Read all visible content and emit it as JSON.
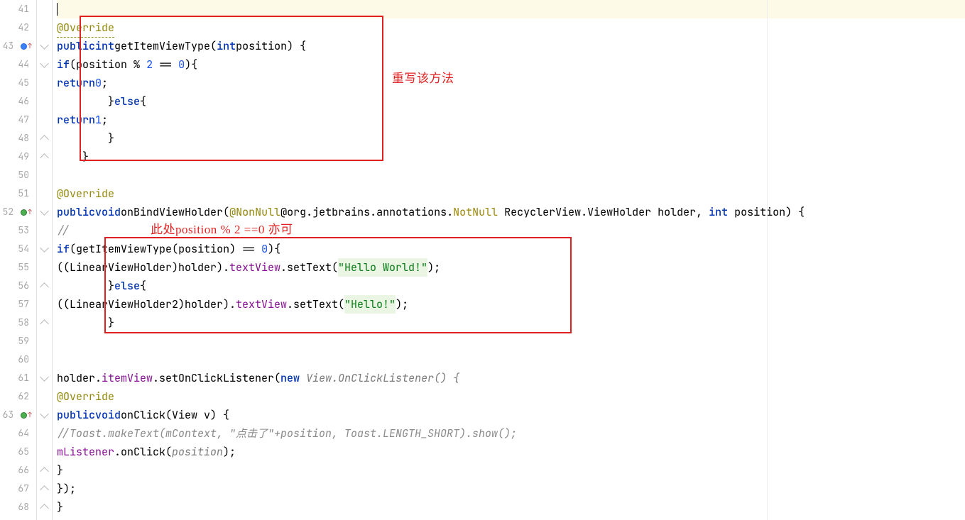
{
  "lines": {
    "start": 41,
    "end": 68
  },
  "annotations": {
    "box1_label": "重写该方法",
    "box2_label": "此处position % 2 ==0 亦可"
  },
  "code": {
    "override1": "@Override",
    "getItemViewType": {
      "sig_public": "public",
      "sig_int1": "int",
      "sig_method": "getItemViewType",
      "sig_int2": "int",
      "sig_param": "position"
    },
    "if1_pre": "if",
    "if1_cond_var": "position",
    "if1_cond_op": " % ",
    "if1_cond_2": "2",
    "if1_cond_eq": " == ",
    "if1_cond_0": "0",
    "return0_kw": "return",
    "return0_val": "0",
    "else": "else",
    "return1_kw": "return",
    "return1_val": "1",
    "override2": "@Override",
    "onBind": {
      "public": "public",
      "void": "void",
      "name": "onBindViewHolder",
      "nonnull": "@NonNull",
      "orgpkg": "@org.jetbrains.annotations.",
      "notnull": "NotNull",
      "rest": " RecyclerView.ViewHolder holder, ",
      "int": "int",
      "pos": " position) {"
    },
    "slashslash": "//",
    "if2_pre": "if",
    "if2_call": "getItemViewType",
    "if2_arg": "position",
    "if2_eq": " == ",
    "if2_zero": "0",
    "cast1_pre": "((LinearViewHolder)holder).",
    "cast1_field": "textView",
    "cast1_set": ".setText(",
    "cast1_str": "\"Hello World!\"",
    "cast1_post": ");",
    "else2": "else",
    "cast2_pre": "((LinearViewHolder2)holder).",
    "cast2_field": "textView",
    "cast2_set": ".setText(",
    "cast2_str": "\"Hello!\"",
    "cast2_post": ");",
    "holder_pre": "holder.",
    "holder_itemView": "itemView",
    "holder_setOn": ".setOnClickListener(",
    "holder_new": "new",
    "holder_listener": " View.OnClickListener() {",
    "override3": "@Override",
    "onClick": {
      "public": "public",
      "void": "void",
      "name": "onClick",
      "param": "(View v) {"
    },
    "toast_comment": "//Toast.makeText(mContext, \"点击了\"+position, Toast.LENGTH_SHORT).show();",
    "mListener_pre": "mListener",
    "mListener_call": ".onClick(",
    "mListener_arg": "position",
    "mListener_post": ");",
    "close_inner": "}",
    "close_anon": "});",
    "close_method": "}"
  }
}
